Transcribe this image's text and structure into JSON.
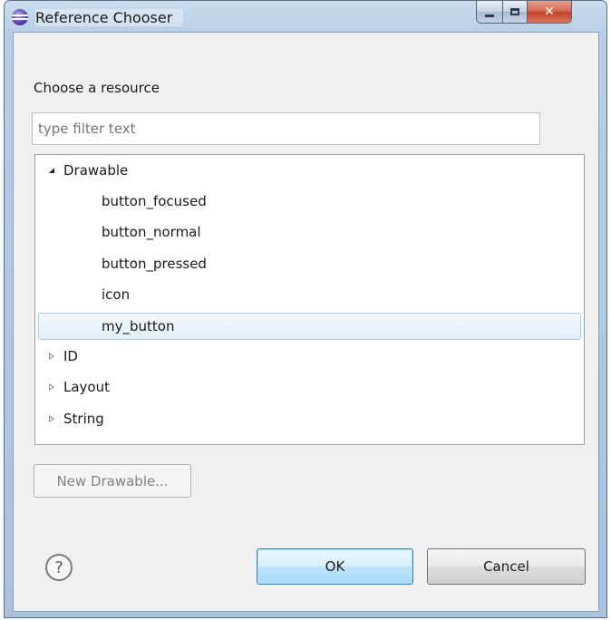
{
  "window": {
    "title": "Reference Chooser"
  },
  "dialog": {
    "prompt": "Choose a resource",
    "filter": {
      "value": "",
      "placeholder": "type filter text"
    },
    "tree": [
      {
        "label": "Drawable",
        "level": 0,
        "expanded": true,
        "has_children": true,
        "selected": false
      },
      {
        "label": "button_focused",
        "level": 1,
        "expanded": false,
        "has_children": false,
        "selected": false
      },
      {
        "label": "button_normal",
        "level": 1,
        "expanded": false,
        "has_children": false,
        "selected": false
      },
      {
        "label": "button_pressed",
        "level": 1,
        "expanded": false,
        "has_children": false,
        "selected": false
      },
      {
        "label": "icon",
        "level": 1,
        "expanded": false,
        "has_children": false,
        "selected": false
      },
      {
        "label": "my_button",
        "level": 1,
        "expanded": false,
        "has_children": false,
        "selected": true
      },
      {
        "label": "ID",
        "level": 0,
        "expanded": false,
        "has_children": true,
        "selected": false
      },
      {
        "label": "Layout",
        "level": 0,
        "expanded": false,
        "has_children": true,
        "selected": false
      },
      {
        "label": "String",
        "level": 0,
        "expanded": false,
        "has_children": true,
        "selected": false
      }
    ],
    "new_button": "New Drawable...",
    "help_glyph": "?",
    "ok_button": "OK",
    "cancel_button": "Cancel"
  },
  "icons": {
    "app": "eclipse-icon",
    "help": "help-icon",
    "minimize": "minimize-icon",
    "maximize": "maximize-icon",
    "close": "close-icon"
  },
  "colors": {
    "selection_background": "#e3eefa",
    "selection_border": "#a9cdeb",
    "close_button": "#c4432a",
    "default_button_border": "#3c7fb1"
  }
}
